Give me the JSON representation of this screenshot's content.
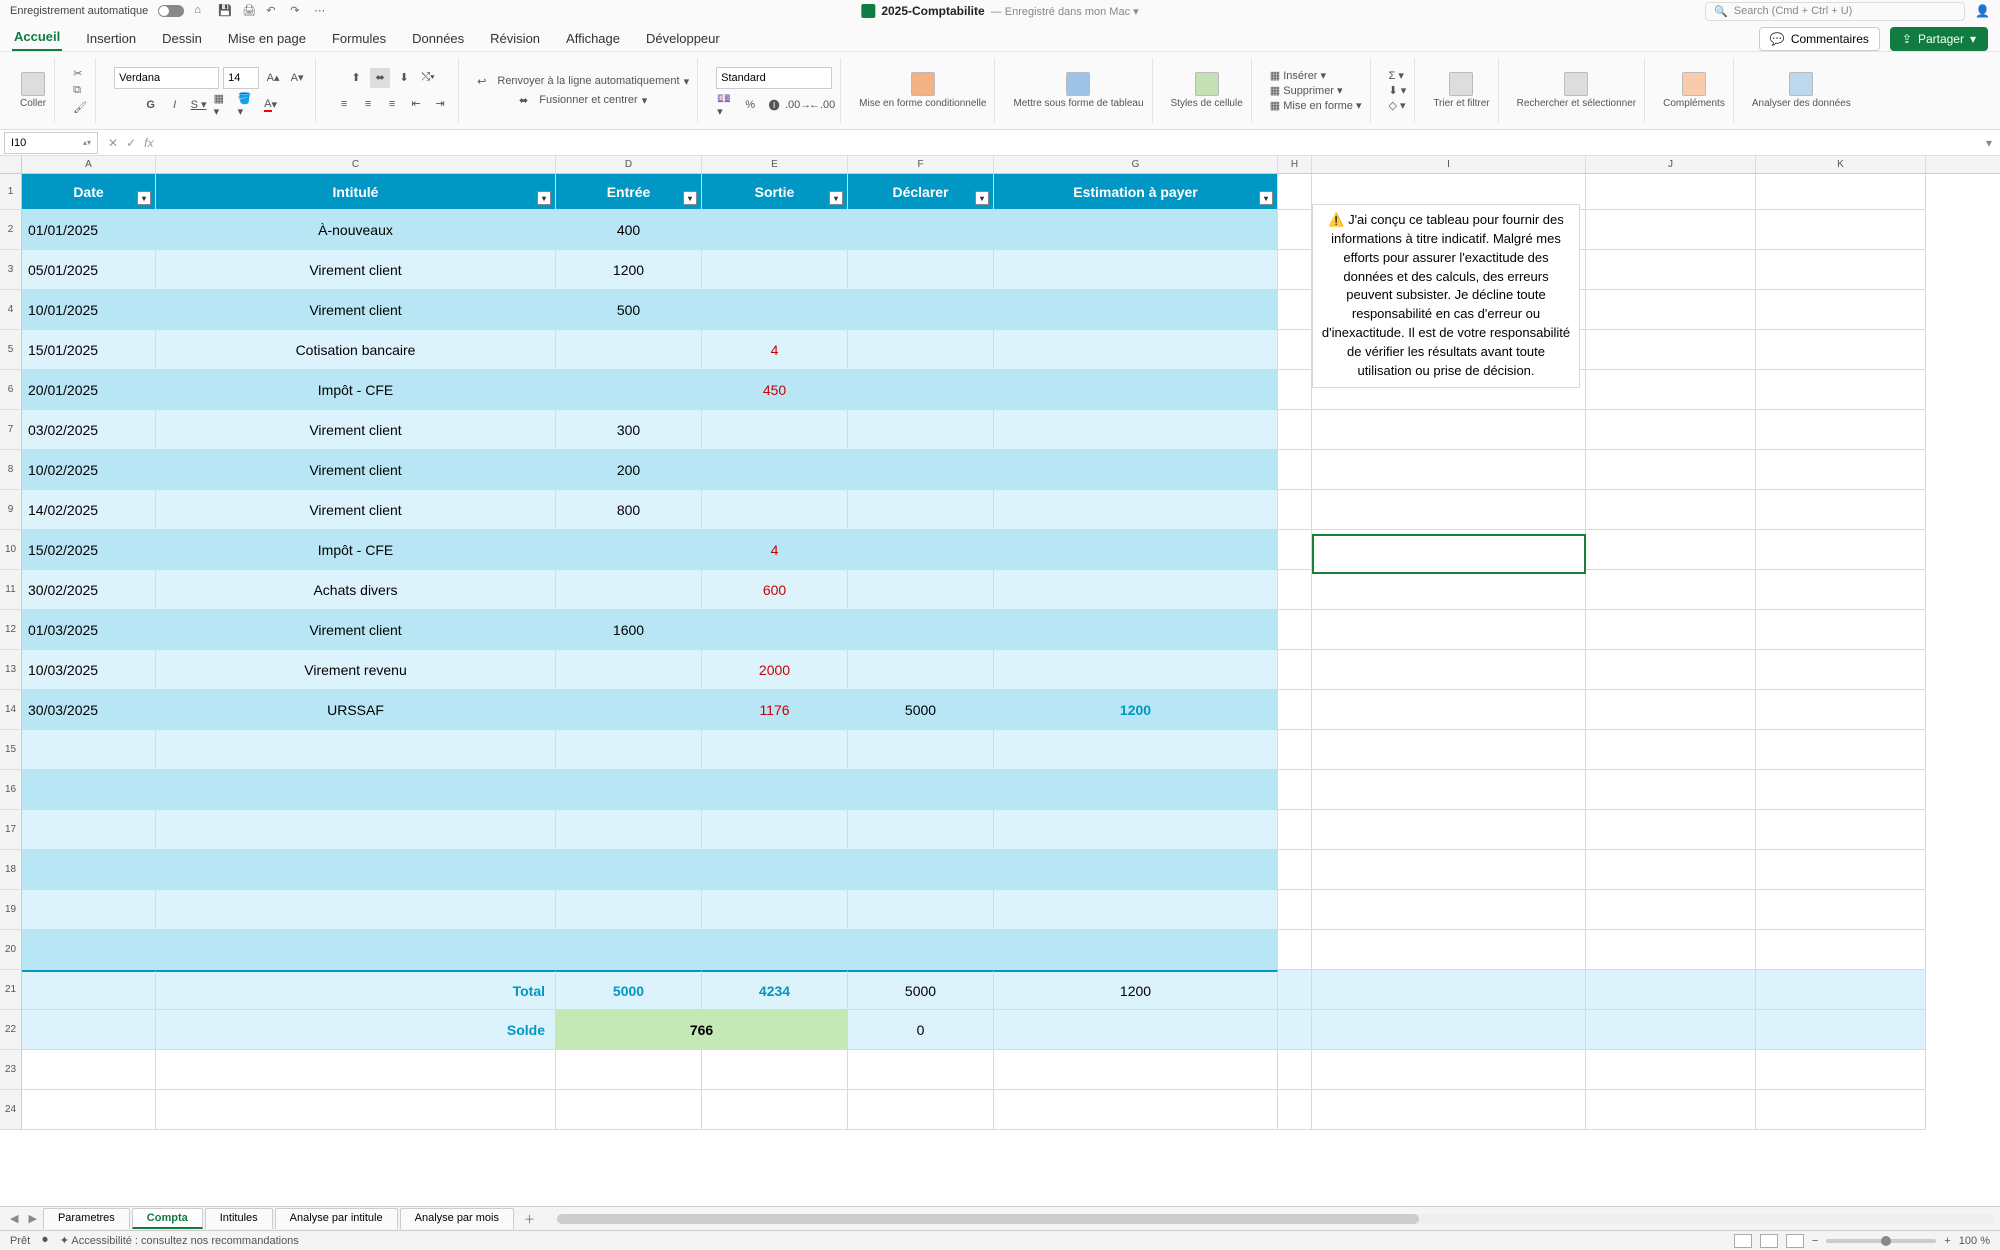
{
  "titlebar": {
    "autosave_label": "Enregistrement automatique",
    "filename": "2025-Comptabilite",
    "saved_label": "Enregistré dans mon Mac",
    "search_placeholder": "Search (Cmd + Ctrl + U)"
  },
  "ribbon_tabs": [
    "Accueil",
    "Insertion",
    "Dessin",
    "Mise en page",
    "Formules",
    "Données",
    "Révision",
    "Affichage",
    "Développeur"
  ],
  "ribbon_right": {
    "comments": "Commentaires",
    "share": "Partager"
  },
  "ribbon": {
    "paste": "Coller",
    "font_name": "Verdana",
    "font_size": "14",
    "wrap": "Renvoyer à la ligne automatiquement",
    "merge": "Fusionner et centrer",
    "number_format": "Standard",
    "cond_format": "Mise en forme conditionnelle",
    "table_format": "Mettre sous forme de tableau",
    "cell_styles": "Styles de cellule",
    "insert": "Insérer",
    "delete": "Supprimer",
    "format": "Mise en forme",
    "sort_filter": "Trier et filtrer",
    "find_select": "Rechercher et sélectionner",
    "addins": "Compléments",
    "analyze": "Analyser des données"
  },
  "name_box": "I10",
  "columns": [
    "A",
    "C",
    "D",
    "E",
    "F",
    "G",
    "H",
    "I",
    "J",
    "K"
  ],
  "headers": {
    "date": "Date",
    "intitule": "Intitulé",
    "entree": "Entrée",
    "sortie": "Sortie",
    "declarer": "Déclarer",
    "estimation": "Estimation à payer"
  },
  "rows": [
    {
      "date": "01/01/2025",
      "intitule": "À-nouveaux",
      "entree": "400",
      "sortie": "",
      "declarer": "",
      "estimation": ""
    },
    {
      "date": "05/01/2025",
      "intitule": "Virement client",
      "entree": "1200",
      "sortie": "",
      "declarer": "",
      "estimation": ""
    },
    {
      "date": "10/01/2025",
      "intitule": "Virement client",
      "entree": "500",
      "sortie": "",
      "declarer": "",
      "estimation": ""
    },
    {
      "date": "15/01/2025",
      "intitule": "Cotisation bancaire",
      "entree": "",
      "sortie": "4",
      "declarer": "",
      "estimation": "",
      "red": true
    },
    {
      "date": "20/01/2025",
      "intitule": "Impôt - CFE",
      "entree": "",
      "sortie": "450",
      "declarer": "",
      "estimation": "",
      "red": true
    },
    {
      "date": "03/02/2025",
      "intitule": "Virement client",
      "entree": "300",
      "sortie": "",
      "declarer": "",
      "estimation": ""
    },
    {
      "date": "10/02/2025",
      "intitule": "Virement client",
      "entree": "200",
      "sortie": "",
      "declarer": "",
      "estimation": ""
    },
    {
      "date": "14/02/2025",
      "intitule": "Virement client",
      "entree": "800",
      "sortie": "",
      "declarer": "",
      "estimation": ""
    },
    {
      "date": "15/02/2025",
      "intitule": "Impôt - CFE",
      "entree": "",
      "sortie": "4",
      "declarer": "",
      "estimation": "",
      "red": true
    },
    {
      "date": "30/02/2025",
      "intitule": "Achats divers",
      "entree": "",
      "sortie": "600",
      "declarer": "",
      "estimation": "",
      "red": true
    },
    {
      "date": "01/03/2025",
      "intitule": "Virement client",
      "entree": "1600",
      "sortie": "",
      "declarer": "",
      "estimation": ""
    },
    {
      "date": "10/03/2025",
      "intitule": "Virement revenu",
      "entree": "",
      "sortie": "2000",
      "declarer": "",
      "estimation": "",
      "red": true
    },
    {
      "date": "30/03/2025",
      "intitule": "URSSAF",
      "entree": "",
      "sortie": "1176",
      "declarer": "5000",
      "estimation": "1200",
      "red": true,
      "est_teal": true
    }
  ],
  "totals": {
    "label": "Total",
    "entree": "5000",
    "sortie": "4234",
    "declarer": "5000",
    "estimation": "1200"
  },
  "solde": {
    "label": "Solde",
    "value": "766",
    "declarer": "0"
  },
  "note": "⚠️ J'ai conçu ce tableau pour fournir des informations à titre indicatif. Malgré mes efforts pour assurer l'exactitude des données et des calculs, des erreurs peuvent subsister. Je décline toute responsabilité en cas d'erreur ou d'inexactitude. Il est de votre responsabilité de vérifier les résultats avant toute utilisation ou prise de décision.",
  "sheets": [
    "Parametres",
    "Compta",
    "Intitules",
    "Analyse par intitule",
    "Analyse par mois"
  ],
  "active_sheet": 1,
  "status": {
    "ready": "Prêt",
    "accessibility": "Accessibilité : consultez nos recommandations",
    "zoom": "100 %"
  }
}
